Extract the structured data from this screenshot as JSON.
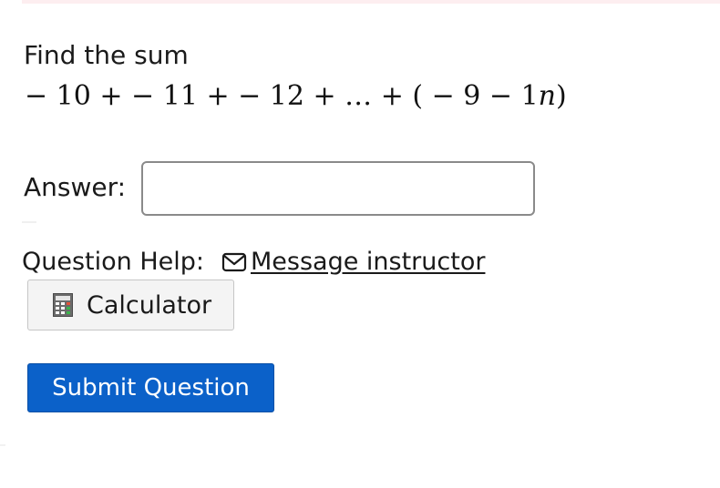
{
  "question": {
    "prompt": "Find the sum",
    "expression": {
      "part1": "− 10 +  − 11 +  − 12 + … + ( − 9 − 1",
      "variable": "n",
      "close": ")"
    }
  },
  "answer": {
    "label": "Answer:",
    "value": "",
    "placeholder": ""
  },
  "help": {
    "label": "Question Help:",
    "message_link": "Message instructor",
    "message_icon": "envelope-icon"
  },
  "calculator": {
    "label": "Calculator",
    "icon": "calculator-icon"
  },
  "submit": {
    "label": "Submit Question"
  },
  "colors": {
    "submit_bg": "#0b61c9",
    "calc_bg": "#f4f4f4",
    "text": "#1a1a1a"
  }
}
